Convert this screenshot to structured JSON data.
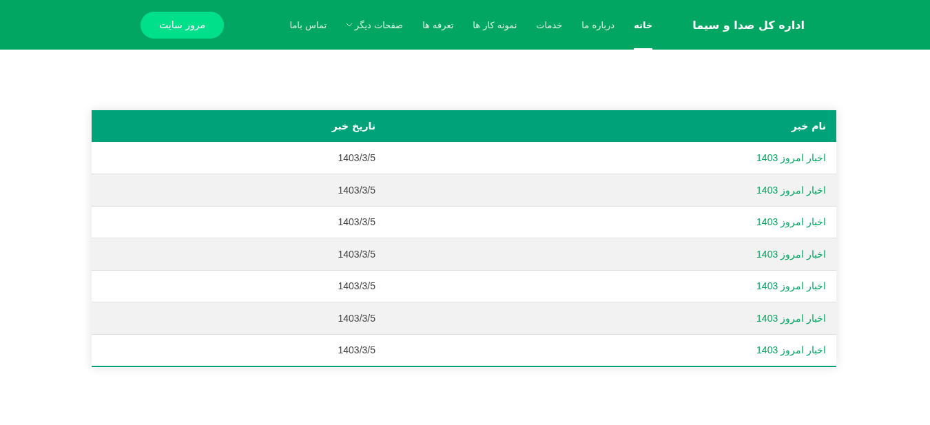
{
  "navbar": {
    "brand": "اداره کل صدا و سیما",
    "items": [
      {
        "label": "خانه",
        "selected": true,
        "dropdown": false
      },
      {
        "label": "درباره ما",
        "selected": false,
        "dropdown": false
      },
      {
        "label": "خدمات",
        "selected": false,
        "dropdown": false
      },
      {
        "label": "نمونه کار ها",
        "selected": false,
        "dropdown": false
      },
      {
        "label": "تعرفه ها",
        "selected": false,
        "dropdown": false
      },
      {
        "label": "صفحات دیگر",
        "selected": false,
        "dropdown": true
      },
      {
        "label": "تماس باما",
        "selected": false,
        "dropdown": false
      }
    ],
    "button": "مرور سایت"
  },
  "table": {
    "columns": [
      "نام خبر",
      "تاریخ خبر"
    ],
    "rows": [
      [
        "اخبار امروز 1403",
        "1403/3/5"
      ],
      [
        "اخبار امروز 1403",
        "1403/3/5"
      ],
      [
        "اخبار امروز 1403",
        "1403/3/5"
      ],
      [
        "اخبار امروز 1403",
        "1403/3/5"
      ],
      [
        "اخبار امروز 1403",
        "1403/3/5"
      ],
      [
        "اخبار امروز 1403",
        "1403/3/5"
      ],
      [
        "اخبار امروز 1403",
        "1403/3/5"
      ]
    ]
  }
}
